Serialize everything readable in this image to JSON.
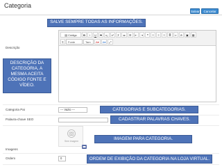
{
  "header": {
    "title": "Categoria",
    "save_label": "Salvar",
    "cancel_label": "Cancelar"
  },
  "callouts": {
    "save_all": "SALVE SEMPRE TODAS AS INFORMAÇÕES.",
    "description_help": "DESCRIÇÃO DA\nCATEGORIA, A\nMESMA ACEITA\nCÓDIGO FONTE E\nVÍDEO.",
    "categories": "CATEGORIAS E SUBCATEGORIAS.",
    "keywords": "CADASTRAR PALAVRAS CHAVES.",
    "image": "IMAGEM PARA CATEGORIA.",
    "order": "ORDEM DE EXIBIÇÃO DA CATEGORIA NA LOJA VIRTUAL."
  },
  "form": {
    "description_label": "Descrição",
    "parent_label": "Categoria Pai",
    "parent_value": "--- Vazio ---",
    "seo_label": "Palavra-chave SEO",
    "seo_value": "",
    "images_label": "Imagens",
    "image_placeholder_text": "Sem imagem",
    "order_label": "Ordem",
    "order_value": "0"
  },
  "editor": {
    "source_label": "Código Fonte",
    "format_placeholder": "Fonte",
    "size_placeholder": "Tam"
  },
  "colors": {
    "callout_bg": "#4e73b8",
    "button_primary": "#3a8ad1"
  },
  "icons": [
    "source-icon",
    "bold-icon",
    "italic-icon",
    "underline-icon",
    "strikethrough-icon",
    "subscript-icon",
    "superscript-icon",
    "remove-format-icon",
    "numbered-list-icon",
    "bullet-list-icon",
    "outdent-icon",
    "indent-icon",
    "blockquote-icon",
    "align-left-icon",
    "align-center-icon",
    "align-right-icon",
    "justify-icon",
    "link-icon",
    "unlink-icon",
    "image-icon",
    "table-icon",
    "text-color-icon",
    "background-color-icon",
    "fullscreen-icon",
    "upload-icon"
  ]
}
